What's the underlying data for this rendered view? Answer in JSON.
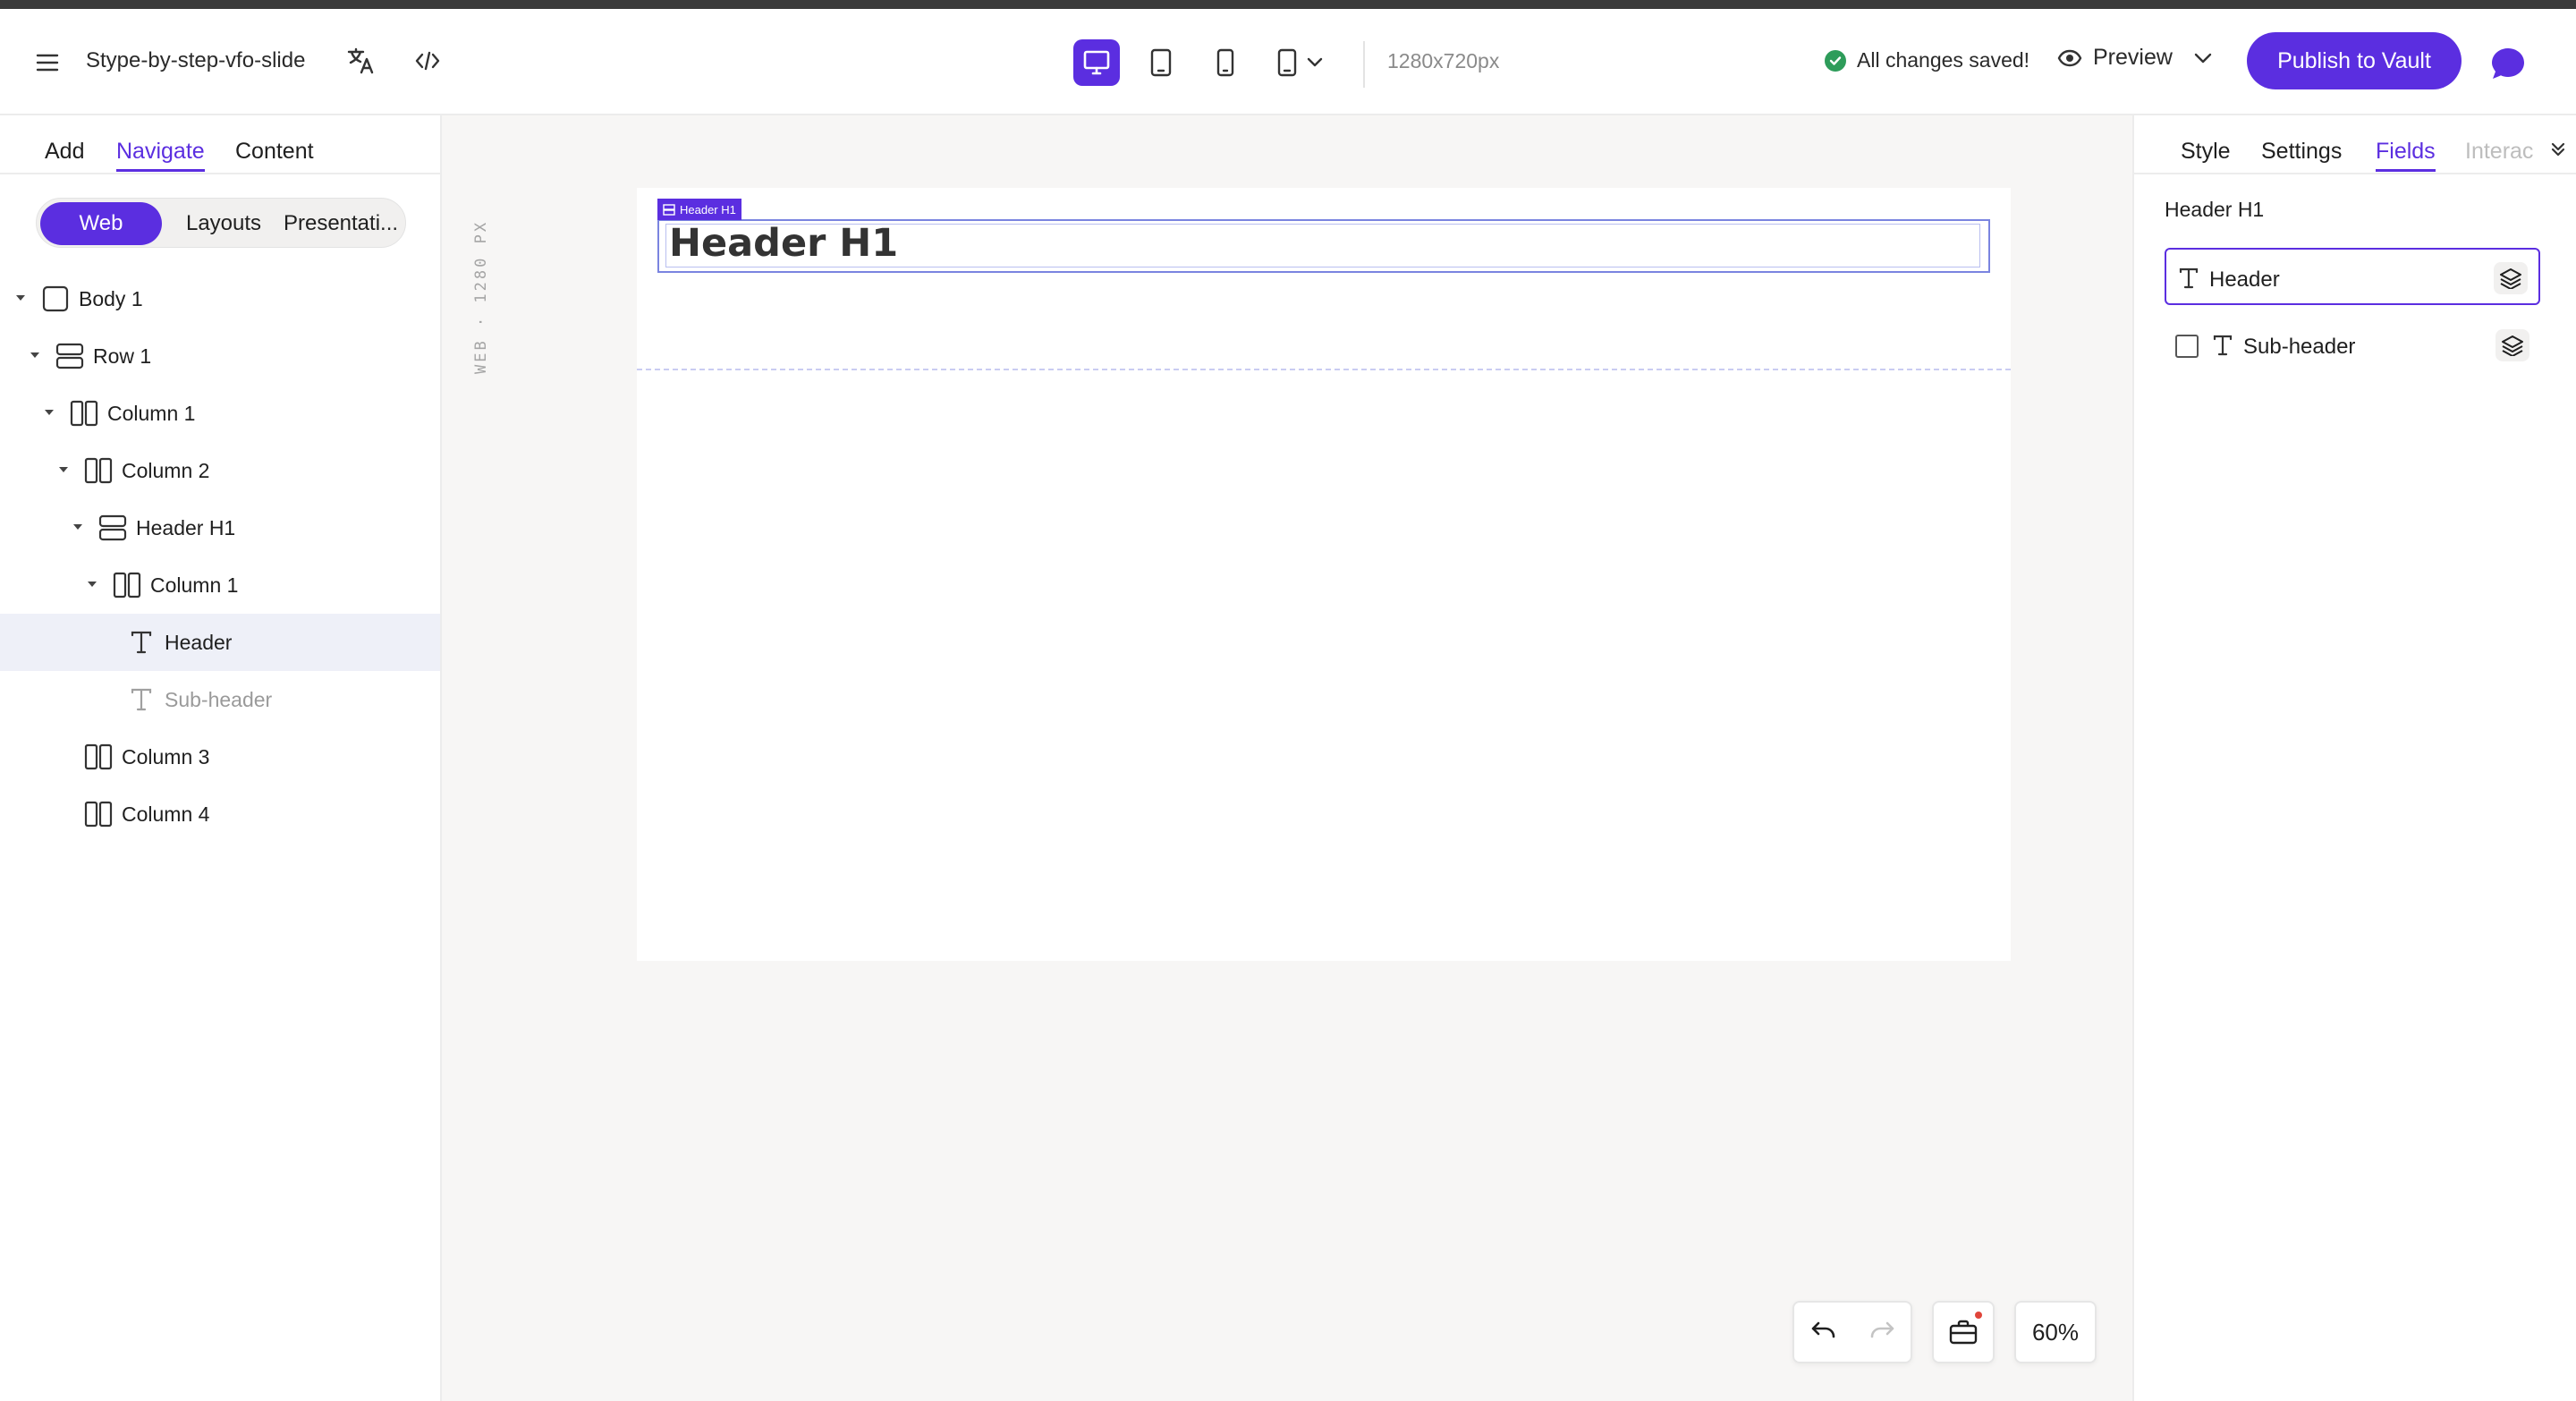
{
  "header": {
    "doc_title": "Stype-by-step-vfo-slide",
    "resolution": "1280x720px",
    "save_status": "All changes saved!",
    "preview_label": "Preview",
    "publish_label": "Publish to Vault",
    "active_device": "desktop",
    "accent_color": "#5b2ee0"
  },
  "left_panel": {
    "tabs": [
      {
        "label": "Add",
        "active": false
      },
      {
        "label": "Navigate",
        "active": true
      },
      {
        "label": "Content",
        "active": false
      }
    ],
    "segments": [
      {
        "label": "Web",
        "active": true
      },
      {
        "label": "Layouts",
        "active": false
      },
      {
        "label": "Presentati...",
        "active": false
      }
    ],
    "tree": [
      {
        "label": "Body 1",
        "icon": "body-icon",
        "expanded": true,
        "depth": 0
      },
      {
        "label": "Row 1",
        "icon": "row-icon",
        "expanded": true,
        "depth": 1
      },
      {
        "label": "Column 1",
        "icon": "column-icon",
        "expanded": true,
        "depth": 2
      },
      {
        "label": "Column 2",
        "icon": "column-icon",
        "expanded": true,
        "depth": 3
      },
      {
        "label": "Header H1",
        "icon": "row-icon",
        "expanded": true,
        "depth": 4
      },
      {
        "label": "Column 1",
        "icon": "column-icon",
        "expanded": true,
        "depth": 5
      },
      {
        "label": "Header",
        "icon": "text-icon",
        "selected": true,
        "depth": 6
      },
      {
        "label": "Sub-header",
        "icon": "text-icon",
        "dimmed": true,
        "depth": 6
      },
      {
        "label": "Column 3",
        "icon": "column-icon",
        "depth": 3
      },
      {
        "label": "Column 4",
        "icon": "column-icon",
        "depth": 3
      }
    ]
  },
  "canvas": {
    "ruler_label": "WEB · 1280 PX",
    "selection_tag": "Header H1",
    "header_text": "Header H1",
    "zoom": "60%"
  },
  "right_panel": {
    "tabs": [
      {
        "label": "Style",
        "active": false
      },
      {
        "label": "Settings",
        "active": false
      },
      {
        "label": "Fields",
        "active": true
      },
      {
        "label": "Interac",
        "active": false
      }
    ],
    "group_title": "Header H1",
    "fields": [
      {
        "label": "Header",
        "active": true,
        "has_checkbox": false
      },
      {
        "label": "Sub-header",
        "active": false,
        "has_checkbox": true,
        "checked": false
      }
    ]
  }
}
